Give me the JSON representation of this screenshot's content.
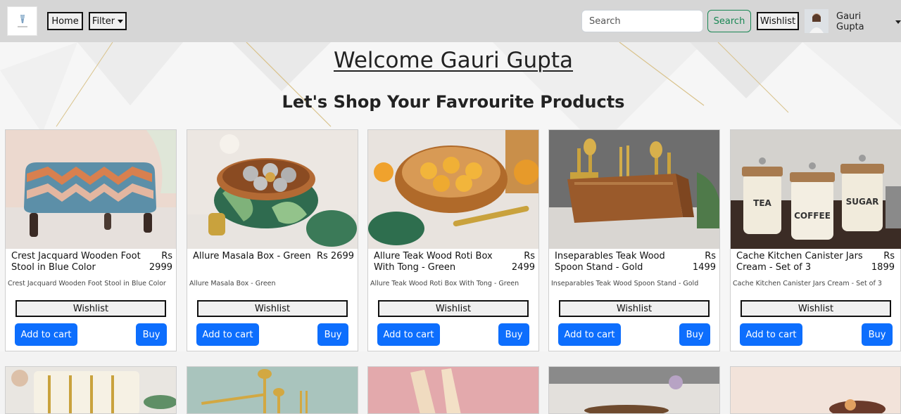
{
  "nav": {
    "home_label": "Home",
    "filter_label": "Filter",
    "search_placeholder": "Search",
    "search_button": "Search",
    "wishlist_label": "Wishlist",
    "user_name": "Gauri Gupta"
  },
  "header": {
    "welcome": "Welcome Gauri Gupta",
    "subtitle": "Let's Shop Your Favrourite Products"
  },
  "products": [
    {
      "title": "Crest Jacquard Wooden Foot Stool in Blue Color",
      "price": "Rs 2999",
      "description": "Crest Jacquard Wooden Foot Stool in Blue Color",
      "wishlist_label": "Wishlist",
      "cart_label": "Add to cart",
      "buy_label": "Buy"
    },
    {
      "title": "Allure Masala Box - Green",
      "price": "Rs 2699",
      "description": "Allure Masala Box - Green",
      "wishlist_label": "Wishlist",
      "cart_label": "Add to cart",
      "buy_label": "Buy"
    },
    {
      "title": "Allure Teak Wood Roti Box With Tong - Green",
      "price": "Rs 2499",
      "description": "Allure Teak Wood Roti Box With Tong - Green",
      "wishlist_label": "Wishlist",
      "cart_label": "Add to cart",
      "buy_label": "Buy"
    },
    {
      "title": "Inseparables Teak Wood Spoon Stand - Gold",
      "price": "Rs 1499",
      "description": "Inseparables Teak Wood Spoon Stand - Gold",
      "wishlist_label": "Wishlist",
      "cart_label": "Add to cart",
      "buy_label": "Buy"
    },
    {
      "title": "Cache Kitchen Canister Jars Cream - Set of 3",
      "price": "Rs 1899",
      "description": "Cache Kitchen Canister Jars Cream - Set of 3",
      "wishlist_label": "Wishlist",
      "cart_label": "Add to cart",
      "buy_label": "Buy"
    }
  ],
  "jar_labels": [
    "TEA",
    "COFFEE",
    "SUGAR"
  ],
  "colors": {
    "navbar": "#d6d6d6",
    "primary": "#0d6efd",
    "success": "#198754"
  }
}
